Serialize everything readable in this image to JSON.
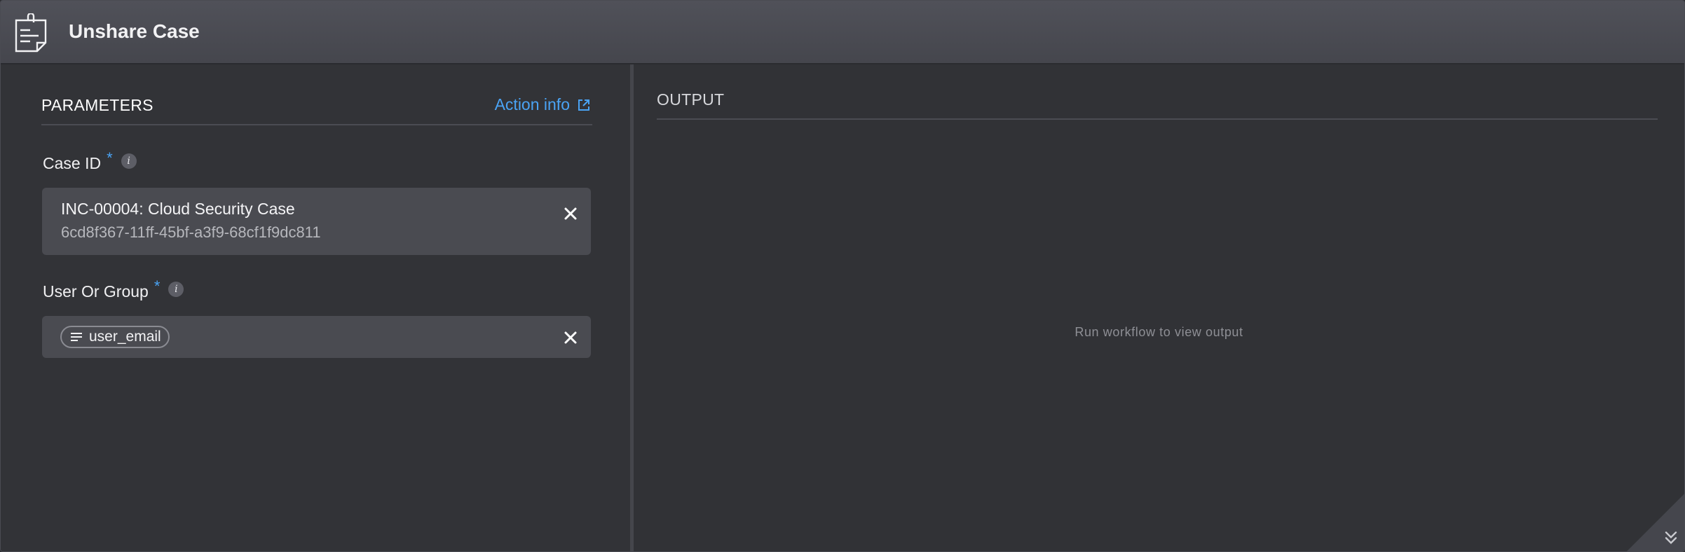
{
  "header": {
    "title": "Unshare Case",
    "icon": "clipboard-note-icon"
  },
  "parameters": {
    "title": "PARAMETERS",
    "action_info_label": "Action info",
    "case_id": {
      "label": "Case ID",
      "required_mark": "*",
      "info_glyph": "i",
      "value_title": "INC-00004: Cloud Security Case",
      "value_id": "6cd8f367-11ff-45bf-a3f9-68cf1f9dc811"
    },
    "user_or_group": {
      "label": "User Or Group",
      "required_mark": "*",
      "info_glyph": "i",
      "chip_label": "user_email"
    }
  },
  "output": {
    "title": "OUTPUT",
    "placeholder": "Run workflow to view output"
  },
  "colors": {
    "accent": "#4aa3f4",
    "panel": "#323337",
    "header": "#4c4d55",
    "field": "#4a4b51"
  }
}
